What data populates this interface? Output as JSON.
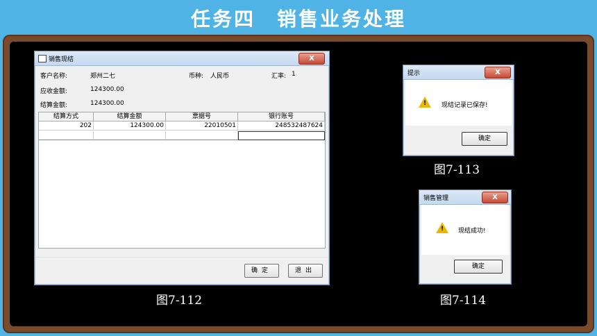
{
  "slide": {
    "title": "任务四　销售业务处理"
  },
  "main_window": {
    "title": "销售现结",
    "close_label": "X",
    "customer_label": "客户名称:",
    "customer_value": "郑州二七",
    "currency_label": "币种:",
    "currency_value": "人民币",
    "rate_label": "汇率:",
    "rate_value": "1",
    "receivable_label": "应收金额:",
    "receivable_value": "124300.00",
    "settle_label": "结算金额:",
    "settle_value": "124300.00",
    "grid": {
      "headers": [
        "结算方式",
        "结算金额",
        "票据号",
        "银行账号"
      ],
      "rows": [
        [
          "202",
          "124300.00",
          "22010501",
          "248532487624"
        ]
      ]
    },
    "confirm_label": "确定",
    "exit_label": "退出"
  },
  "dialog_saved": {
    "title": "提示",
    "close_label": "X",
    "message": "现结记录已保存!",
    "ok_label": "确定"
  },
  "dialog_success": {
    "title": "销售管理",
    "close_label": "X",
    "message": "现结成功!",
    "ok_label": "确定"
  },
  "captions": {
    "fig112": "图7-112",
    "fig113": "图7-113",
    "fig114": "图7-114"
  },
  "colors": {
    "header_bg": "#4fb3e6",
    "frame": "#7a4a2c",
    "board": "#000000",
    "warning": "#e8b800"
  }
}
